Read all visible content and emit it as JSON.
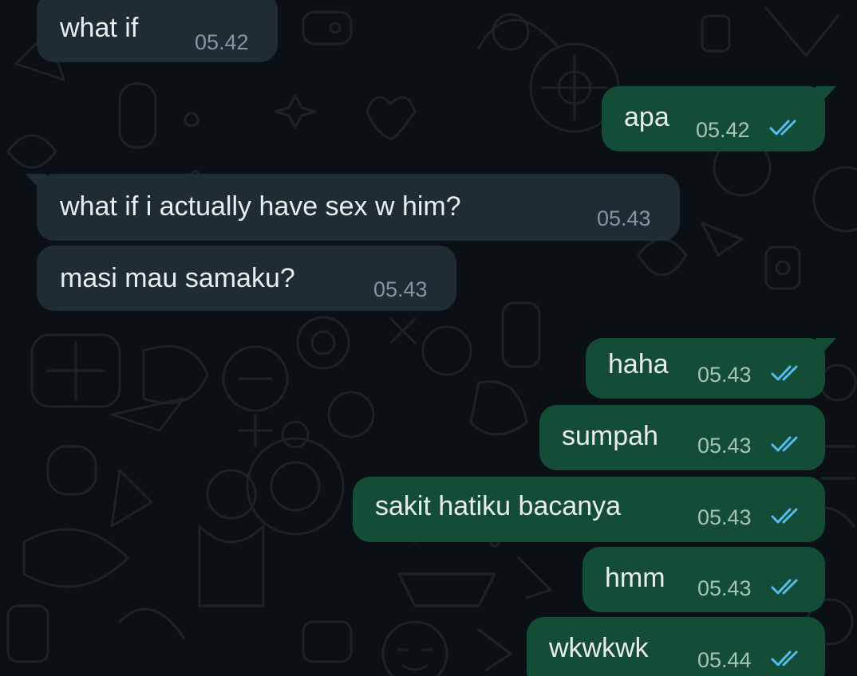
{
  "messages": [
    {
      "text": "what if",
      "time": "05.42",
      "direction": "incoming"
    },
    {
      "text": "apa",
      "time": "05.42",
      "direction": "outgoing",
      "status": "read"
    },
    {
      "text": "what if i actually have sex w him?",
      "time": "05.43",
      "direction": "incoming"
    },
    {
      "text": "masi mau samaku?",
      "time": "05.43",
      "direction": "incoming"
    },
    {
      "text": "haha",
      "time": "05.43",
      "direction": "outgoing",
      "status": "read"
    },
    {
      "text": "sumpah",
      "time": "05.43",
      "direction": "outgoing",
      "status": "read"
    },
    {
      "text": "sakit hatiku bacanya",
      "time": "05.43",
      "direction": "outgoing",
      "status": "read"
    },
    {
      "text": "hmm",
      "time": "05.43",
      "direction": "outgoing",
      "status": "read"
    },
    {
      "text": "wkwkwk",
      "time": "05.44",
      "direction": "outgoing",
      "status": "read"
    }
  ],
  "read_receipt_icon": "double-check-icon",
  "colors": {
    "background": "#0b1014",
    "incoming_bubble": "#1f2c33",
    "outgoing_bubble": "#144d37",
    "message_text": "#e9edef",
    "time_text": "#8696a0",
    "read_tick": "#53bdeb"
  }
}
